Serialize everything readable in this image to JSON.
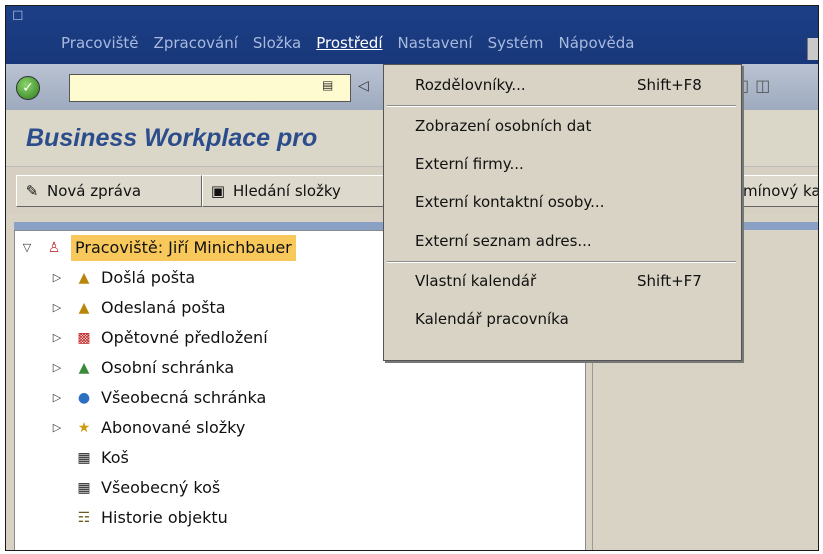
{
  "menubar": {
    "items": [
      "Pracoviště",
      "Zpracování",
      "Složka",
      "Prostředí",
      "Nastavení",
      "Systém",
      "Nápověda"
    ],
    "active_index": 3
  },
  "toolbar": {
    "ok_icon": "checkmark-icon",
    "command_value": ""
  },
  "title": "Business Workplace pro",
  "app_toolbar": {
    "new_message": "Nová zpráva",
    "search_folder": "Hledání složky",
    "right_truncated": "mínový ka"
  },
  "tree": {
    "root": {
      "label": "Pracoviště: Jiří Minichbauer",
      "icon": "workplace-person-icon"
    },
    "children": [
      {
        "label": "Došlá pošta",
        "icon": "inbox-icon",
        "expandable": true
      },
      {
        "label": "Odeslaná pošta",
        "icon": "outbox-icon",
        "expandable": true
      },
      {
        "label": "Opětovné předložení",
        "icon": "resubmission-icon",
        "expandable": true
      },
      {
        "label": "Osobní schránka",
        "icon": "private-folder-icon",
        "expandable": true
      },
      {
        "label": "Všeobecná schránka",
        "icon": "shared-folder-icon",
        "expandable": true
      },
      {
        "label": "Abonované složky",
        "icon": "subscribed-folder-icon",
        "expandable": true
      },
      {
        "label": "Koš",
        "icon": "trash-icon",
        "expandable": false
      },
      {
        "label": "Všeobecný koš",
        "icon": "shared-trash-icon",
        "expandable": false
      },
      {
        "label": "Historie objektu",
        "icon": "history-icon",
        "expandable": false
      }
    ]
  },
  "dropdown": {
    "items": [
      {
        "label": "Rozdělovníky...",
        "shortcut": "Shift+F8"
      },
      {
        "label": "Zobrazení osobních dat",
        "shortcut": ""
      },
      {
        "label": "Externí firmy...",
        "shortcut": ""
      },
      {
        "label": "Externí kontaktní osoby...",
        "shortcut": ""
      },
      {
        "label": "Externí seznam adres...",
        "shortcut": ""
      },
      {
        "label": "Vlastní kalendář",
        "shortcut": "Shift+F7"
      },
      {
        "label": "Kalendář pracovníka",
        "shortcut": ""
      }
    ]
  },
  "colors": {
    "menubar": "#1c3f86",
    "title": "#2b4d8c",
    "command_field": "#fffbd0",
    "root_highlight": "#f8c95a"
  }
}
